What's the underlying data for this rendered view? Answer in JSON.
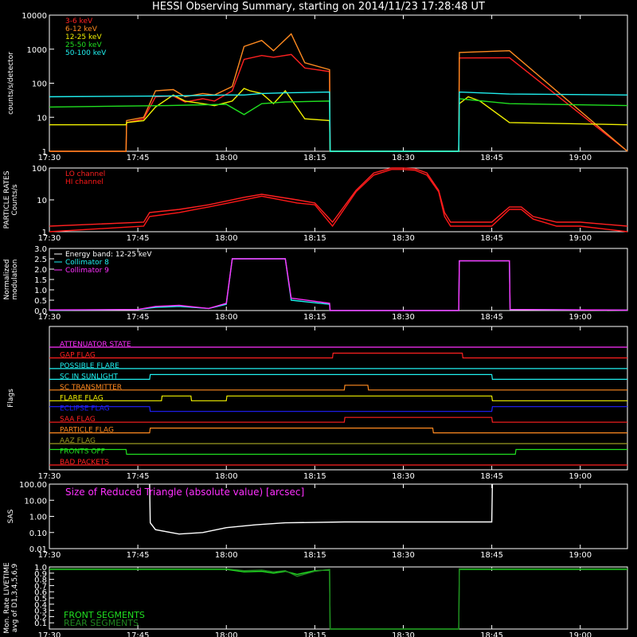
{
  "title": "HESSI Observing Summary, starting on 2014/11/23 17:28:48 UT",
  "x_tick_labels": [
    "17:30",
    "17:45",
    "18:00",
    "18:15",
    "18:30",
    "18:45",
    "19:00"
  ],
  "x_tick_minutes": [
    0,
    15,
    30,
    45,
    60,
    75,
    90
  ],
  "x_range_minutes": [
    0,
    98
  ],
  "colors": {
    "red": "#ff2020",
    "orange": "#ff8a20",
    "yellow": "#f0f000",
    "green": "#20e020",
    "cyan": "#20f0f0",
    "magenta": "#ff30ff",
    "white": "#ffffff",
    "blue": "#2020ff",
    "olive": "#9a9a20",
    "darkgreen": "#208820",
    "brightred": "#ff1818"
  },
  "chart_data": [
    {
      "type": "line",
      "ylabel": "counts/s/detector",
      "yscale": "log",
      "ylim": [
        1,
        10000
      ],
      "y_tick_labels": [
        "1",
        "10",
        "100",
        "1000",
        "10000"
      ],
      "legend_placement": "top-left",
      "series": [
        {
          "name": "3-6 keV",
          "color": "red",
          "x": [
            0,
            13,
            13.1,
            16,
            18,
            21,
            23,
            26,
            28,
            31,
            33,
            36,
            38,
            41,
            43.3,
            47.5,
            47.6,
            69.4,
            69.5,
            78,
            98
          ],
          "values": [
            1,
            1,
            7,
            9,
            40,
            42,
            28,
            35,
            30,
            60,
            500,
            650,
            580,
            700,
            280,
            220,
            0,
            0,
            550,
            560,
            1
          ]
        },
        {
          "name": "6-12 keV",
          "color": "orange",
          "x": [
            0,
            13,
            13.1,
            16,
            18,
            21,
            23,
            26,
            28,
            31,
            33,
            36,
            38,
            41,
            43.3,
            47.5,
            47.6,
            69.4,
            69.5,
            78,
            98
          ],
          "values": [
            1,
            1,
            8,
            10,
            60,
            65,
            40,
            50,
            45,
            80,
            1200,
            1800,
            900,
            2800,
            400,
            250,
            0,
            0,
            800,
            900,
            1
          ]
        },
        {
          "name": "12-25 keV",
          "color": "yellow",
          "x": [
            0,
            13,
            13.1,
            16,
            18,
            21,
            23,
            26,
            28,
            31,
            33,
            34,
            36,
            38,
            40,
            43.3,
            47.5,
            47.6,
            69.4,
            69.5,
            71,
            73,
            78,
            98
          ],
          "values": [
            6,
            6,
            7,
            8,
            20,
            45,
            30,
            25,
            22,
            30,
            70,
            60,
            50,
            25,
            60,
            9,
            8,
            0,
            0,
            25,
            40,
            30,
            7,
            6
          ]
        },
        {
          "name": "25-50 keV",
          "color": "green",
          "x": [
            0,
            20,
            30,
            33,
            36,
            40,
            47.5,
            47.6,
            69.4,
            69.5,
            78,
            98
          ],
          "values": [
            20,
            22,
            24,
            12,
            25,
            28,
            30,
            0,
            0,
            35,
            25,
            22
          ]
        },
        {
          "name": "50-100 keV",
          "color": "cyan",
          "x": [
            0,
            20,
            30,
            33,
            36,
            40,
            47.5,
            47.6,
            69.4,
            69.5,
            78,
            98
          ],
          "values": [
            40,
            42,
            45,
            45,
            50,
            52,
            55,
            0,
            0,
            55,
            48,
            45
          ]
        }
      ]
    },
    {
      "type": "line",
      "ylabel": "PARTICLE RATES Counts/s",
      "yscale": "log",
      "ylim": [
        1,
        100
      ],
      "y_tick_labels": [
        "1",
        "10",
        "100"
      ],
      "legend_placement": "top-left",
      "series": [
        {
          "name": "LO channel",
          "color": "red",
          "x": [
            0,
            16,
            17,
            22,
            27,
            33,
            36,
            42,
            45,
            48,
            52,
            55,
            58,
            60,
            62,
            64,
            66,
            67,
            68,
            70,
            75,
            78,
            80,
            82,
            86,
            90,
            98
          ],
          "values": [
            1.5,
            2,
            4,
            5,
            7,
            12,
            15,
            10,
            8,
            2,
            20,
            70,
            100,
            100,
            95,
            70,
            20,
            4,
            2,
            2,
            2,
            6,
            6,
            3,
            2,
            2,
            1.5
          ]
        },
        {
          "name": "HI channel",
          "color": "brightred",
          "x": [
            0,
            16,
            17,
            22,
            27,
            33,
            36,
            42,
            45,
            48,
            52,
            55,
            58,
            60,
            62,
            64,
            66,
            67,
            68,
            70,
            75,
            78,
            80,
            82,
            86,
            90,
            98
          ],
          "values": [
            1,
            1.5,
            3,
            4,
            6,
            10,
            13,
            8,
            7,
            1.5,
            18,
            60,
            90,
            90,
            85,
            60,
            18,
            3,
            1.5,
            1.5,
            1.5,
            5,
            5,
            2.5,
            1.5,
            1.5,
            1
          ]
        }
      ]
    },
    {
      "type": "line",
      "ylabel": "Normalized modulation",
      "ylim": [
        0,
        3
      ],
      "y_tick_labels": [
        "0.0",
        "0.5",
        "1.0",
        "1.5",
        "2.0",
        "2.5",
        "3.0"
      ],
      "legend_placement": "top-left",
      "legend_header": "Energy band: 12-25 keV",
      "series": [
        {
          "name": "Collimator 8",
          "color": "cyan",
          "x": [
            0,
            15,
            18,
            22,
            27,
            30,
            31,
            40,
            41,
            47.5,
            47.6,
            69.4,
            69.5,
            78,
            78.1,
            98
          ],
          "values": [
            0.02,
            0.05,
            0.15,
            0.2,
            0.1,
            0.3,
            2.5,
            2.5,
            0.5,
            0.3,
            0,
            0,
            2.4,
            2.4,
            0.05,
            0.02
          ]
        },
        {
          "name": "Collimator 9",
          "color": "magenta",
          "x": [
            0,
            15,
            18,
            22,
            27,
            30,
            31,
            40,
            41,
            47.5,
            47.6,
            69.4,
            69.5,
            78,
            78.1,
            98
          ],
          "values": [
            0.03,
            0.05,
            0.2,
            0.25,
            0.1,
            0.35,
            2.5,
            2.5,
            0.6,
            0.35,
            0,
            0,
            2.4,
            2.4,
            0.05,
            0.02
          ]
        }
      ]
    },
    {
      "type": "line",
      "ylabel": "Flags",
      "series": [
        {
          "name": "ATTENUATOR STATE",
          "color": "magenta",
          "x": [
            0,
            98
          ],
          "values": [
            0,
            0
          ]
        },
        {
          "name": "GAP FLAG",
          "color": "red",
          "x": [
            0,
            48,
            48.1,
            70,
            70.1,
            98
          ],
          "values": [
            0,
            0,
            1,
            1,
            0,
            0
          ]
        },
        {
          "name": "POSSIBLE FLARE",
          "color": "cyan",
          "x": [
            0,
            98
          ],
          "values": [
            0,
            0
          ]
        },
        {
          "name": "SC IN SUNLIGHT",
          "color": "cyan",
          "x": [
            0,
            17,
            17.1,
            75,
            75.1,
            98
          ],
          "values": [
            0,
            0,
            1,
            1,
            0,
            0
          ]
        },
        {
          "name": "SC TRANSMITTER",
          "color": "orange",
          "x": [
            0,
            50,
            50.1,
            54,
            54.1,
            98
          ],
          "values": [
            0,
            0,
            1,
            1,
            0,
            0
          ]
        },
        {
          "name": "FLARE FLAG",
          "color": "yellow",
          "x": [
            0,
            19,
            19.1,
            24,
            24.1,
            30,
            30.1,
            75,
            75.1,
            98
          ],
          "values": [
            0,
            0,
            1,
            1,
            0,
            0,
            1,
            1,
            0,
            0
          ]
        },
        {
          "name": "ECLIPSE FLAG",
          "color": "blue",
          "x": [
            0,
            17,
            17.1,
            75,
            75.1,
            98
          ],
          "values": [
            1,
            1,
            0,
            0,
            1,
            1
          ]
        },
        {
          "name": "SAA FLAG",
          "color": "red",
          "x": [
            0,
            50,
            50.1,
            75,
            75.1,
            98
          ],
          "values": [
            0,
            0,
            1,
            1,
            0,
            0
          ]
        },
        {
          "name": "PARTICLE FLAG",
          "color": "orange",
          "x": [
            0,
            17,
            17.1,
            65,
            65.1,
            98
          ],
          "values": [
            0,
            0,
            1,
            1,
            0,
            0
          ]
        },
        {
          "name": "AAZ FLAG",
          "color": "olive",
          "x": [
            0,
            98
          ],
          "values": [
            0,
            0
          ]
        },
        {
          "name": "FRONTS OFF",
          "color": "green",
          "x": [
            0,
            13,
            13.1,
            79,
            79.1,
            98
          ],
          "values": [
            1,
            1,
            0,
            0,
            1,
            1
          ]
        },
        {
          "name": "BAD PACKETS",
          "color": "red",
          "x": [
            0,
            98
          ],
          "values": [
            0,
            0
          ]
        }
      ]
    },
    {
      "type": "line",
      "ylabel": "SAS",
      "yscale": "log",
      "ylim": [
        0.01,
        100
      ],
      "y_tick_labels": [
        "0.01",
        "0.10",
        "1.00",
        "10.00",
        "100.00"
      ],
      "annotation": "Size of Reduced Triangle (absolute value) [arcsec]",
      "series": [
        {
          "color": "white",
          "x": [
            17,
            17.1,
            18,
            22,
            26,
            30,
            35,
            40,
            50,
            60,
            70,
            75,
            75.1
          ],
          "values": [
            100,
            0.4,
            0.15,
            0.08,
            0.1,
            0.2,
            0.3,
            0.4,
            0.45,
            0.45,
            0.45,
            0.45,
            100
          ]
        }
      ]
    },
    {
      "type": "line",
      "ylabel": "Mon. Rate LIVETIME avg of D1,3,4,5,6,9",
      "ylim": [
        0,
        1
      ],
      "y_tick_labels": [
        "0.1",
        "0.2",
        "0.3",
        "0.4",
        "0.5",
        "0.6",
        "0.7",
        "0.8",
        "0.9",
        "1.0"
      ],
      "legend_placement": "bottom-left",
      "series": [
        {
          "name": "FRONT SEGMENTS",
          "color": "green",
          "x": [
            0,
            30,
            33,
            36,
            38,
            40,
            42,
            45,
            47.5,
            47.6,
            69.4,
            69.5,
            98
          ],
          "values": [
            0.96,
            0.96,
            0.92,
            0.93,
            0.9,
            0.93,
            0.88,
            0.94,
            0.95,
            0,
            0,
            0.96,
            0.96
          ]
        },
        {
          "name": "REAR SEGMENTS",
          "color": "darkgreen",
          "x": [
            0,
            30,
            33,
            36,
            38,
            40,
            42,
            45,
            47.5,
            47.6,
            69.4,
            69.5,
            98
          ],
          "values": [
            0.97,
            0.97,
            0.94,
            0.95,
            0.92,
            0.94,
            0.85,
            0.93,
            0.96,
            0,
            0,
            0.97,
            0.97
          ]
        }
      ]
    }
  ]
}
